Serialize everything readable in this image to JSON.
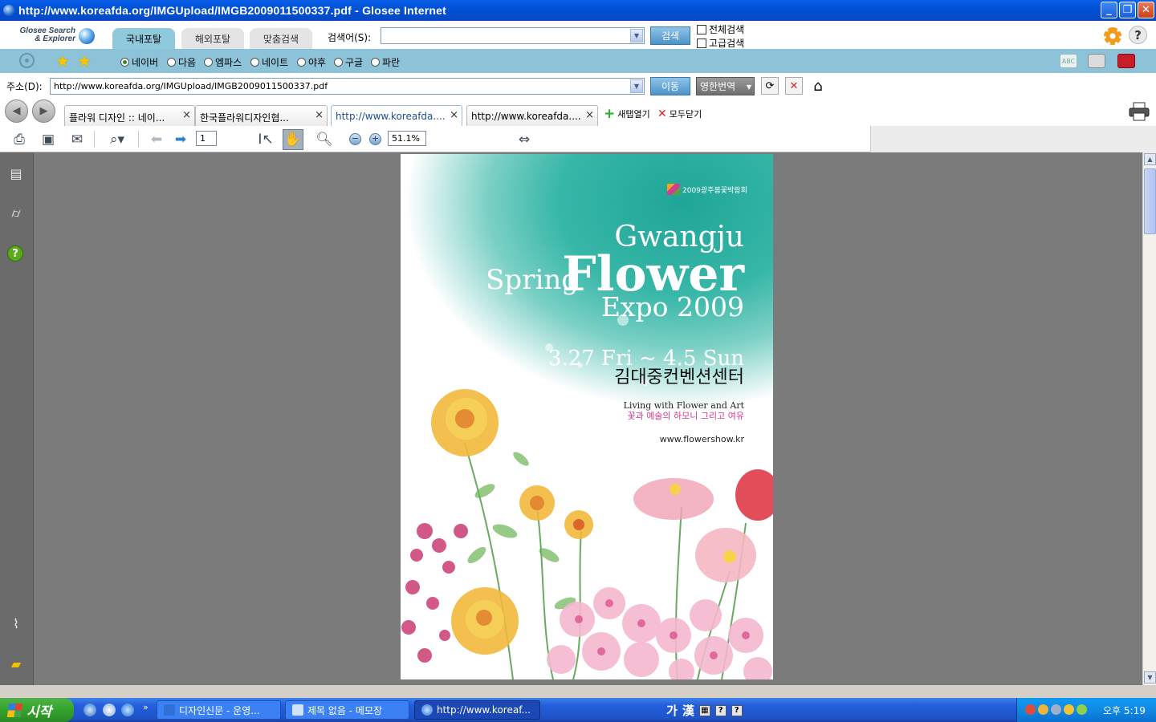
{
  "window": {
    "title": "http://www.koreafda.org/IMGUpload/IMGB2009011500337.pdf - Glosee Internet",
    "minimize": "_",
    "maximize": "❐",
    "close": "✕"
  },
  "portal": {
    "logo_line1": "Glosee Search",
    "logo_line2": "& Explorer",
    "tabs": [
      {
        "label": "국내포탈",
        "active": true
      },
      {
        "label": "해외포탈",
        "active": false
      },
      {
        "label": "맞춤검색",
        "active": false
      }
    ],
    "search_label": "검색어(S):",
    "search_value": "",
    "search_button": "검색",
    "checkbox_all": "전체검색",
    "checkbox_adv": "고급검색",
    "help": "?"
  },
  "engines": {
    "options": [
      {
        "label": "네이버",
        "selected": true
      },
      {
        "label": "다음",
        "selected": false
      },
      {
        "label": "엠파스",
        "selected": false
      },
      {
        "label": "네이트",
        "selected": false
      },
      {
        "label": "야후",
        "selected": false
      },
      {
        "label": "구글",
        "selected": false
      },
      {
        "label": "파란",
        "selected": false
      }
    ],
    "abc": "ABC"
  },
  "address": {
    "label": "주소(D):",
    "url": "http://www.koreafda.org/IMGUpload/IMGB2009011500337.pdf",
    "go_button": "이동",
    "translate_button": "영한번역"
  },
  "tabs": {
    "items": [
      {
        "label": "플라워 디자인 :: 네이...",
        "active": false
      },
      {
        "label": "한국플라워디자인협...",
        "active": false
      },
      {
        "label": "http://www.koreafda....",
        "active": true
      },
      {
        "label": "http://www.koreafda....",
        "active": false
      }
    ],
    "close_glyph": "×",
    "new_tab": "새탭열기",
    "close_all": "모두닫기"
  },
  "pdf": {
    "page": "1",
    "zoom": "51.1%"
  },
  "poster": {
    "logo_text": "2009광주봄꽃박람회",
    "city": "Gwangju",
    "spring": "Spring",
    "flower": "Flower",
    "expo": "Expo 2009",
    "dates": "3.27 Fri ~ 4.5 Sun",
    "venue": "김대중컨벤션센터",
    "tagline_en": "Living with Flower and Art",
    "tagline_ko": "꽃과 예술의 하모니 그리고 여유",
    "url": "www.flowershow.kr"
  },
  "taskbar": {
    "start": "시작",
    "buttons": [
      {
        "label": "디자인신문 - 운영..."
      },
      {
        "label": "제목 없음 - 메모장"
      },
      {
        "label": "http://www.koreaf..."
      }
    ],
    "ime_ga": "가",
    "ime_han": "漢",
    "clock": "오후 5:19"
  },
  "colors": {
    "title_blue": "#0a5ee8",
    "engine_bar": "#8dc3d8",
    "active_portal_tab": "#8fc9dc",
    "viewer_bg": "#7b7b7b",
    "poster_teal": "#1fa597",
    "start_green": "#36a82f"
  }
}
